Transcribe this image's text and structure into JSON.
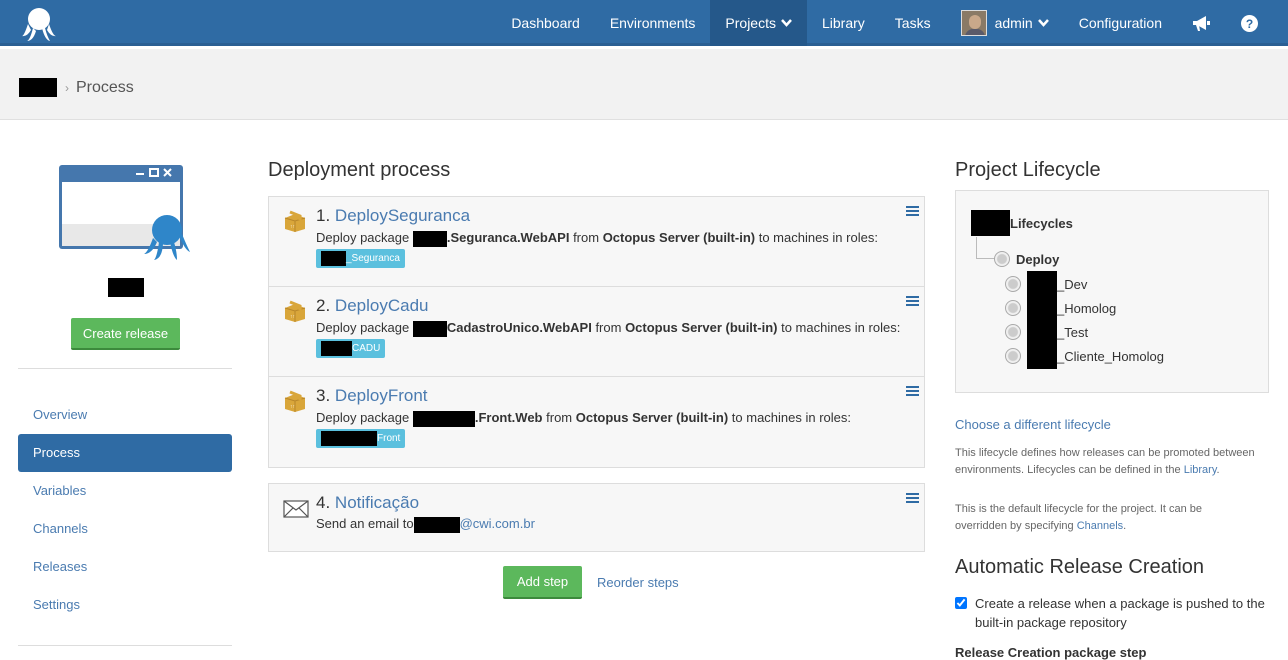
{
  "nav": {
    "items": [
      "Dashboard",
      "Environments",
      "Projects",
      "Library",
      "Tasks",
      "admin",
      "Configuration"
    ]
  },
  "breadcrumb": {
    "current": "Process"
  },
  "sidebar": {
    "create_release": "Create release",
    "items": [
      {
        "label": "Overview"
      },
      {
        "label": "Process"
      },
      {
        "label": "Variables"
      },
      {
        "label": "Channels"
      },
      {
        "label": "Releases"
      },
      {
        "label": "Settings"
      }
    ]
  },
  "process": {
    "title": "Deployment process",
    "steps": [
      {
        "num": "1.",
        "name": "DeploySeguranca",
        "pre": "Deploy package",
        "pkg": ".Seguranca.WebAPI",
        "from": "from",
        "server": "Octopus Server (built-in)",
        "post": "to machines in roles:",
        "role": "_Seguranca"
      },
      {
        "num": "2.",
        "name": "DeployCadu",
        "pre": "Deploy package",
        "pkg": "CadastroUnico.WebAPI",
        "from": "from",
        "server": "Octopus Server (built-in)",
        "post": "to machines in roles:",
        "role": "CADU"
      },
      {
        "num": "3.",
        "name": "DeployFront",
        "pre": "Deploy package",
        "pkg": ".Front.Web",
        "from": "from",
        "server": "Octopus Server (built-in)",
        "post": "to machines in roles:",
        "role": "Front"
      },
      {
        "num": "4.",
        "name": "Notificação",
        "pre": "Send an email to",
        "email": "@cwi.com.br"
      }
    ],
    "add_step": "Add step",
    "reorder": "Reorder steps"
  },
  "lifecycle": {
    "title": "Project Lifecycle",
    "name_suffix": "Lifecycles",
    "phase": "Deploy",
    "environments": [
      "_Dev",
      "_Homolog",
      "_Test",
      "_Cliente_Homolog"
    ],
    "choose": "Choose a different lifecycle",
    "note1_pre": "This lifecycle defines how releases can be promoted between environments. Lifecycles can be defined in the",
    "note1_link": "Library",
    "note1_post": ".",
    "note2_pre": "This is the default lifecycle for the project. It can be overridden by specifying",
    "note2_link": "Channels",
    "note2_post": "."
  },
  "auto_release": {
    "title": "Automatic Release Creation",
    "checkbox_label": "Create a release when a package is pushed to the built-in package repository",
    "checked": true,
    "package_step_label": "Release Creation package step"
  },
  "colors": {
    "nav": "#2f6ba4",
    "green": "#5cb85c",
    "link": "#4a7bb0",
    "role": "#5bc0de"
  }
}
